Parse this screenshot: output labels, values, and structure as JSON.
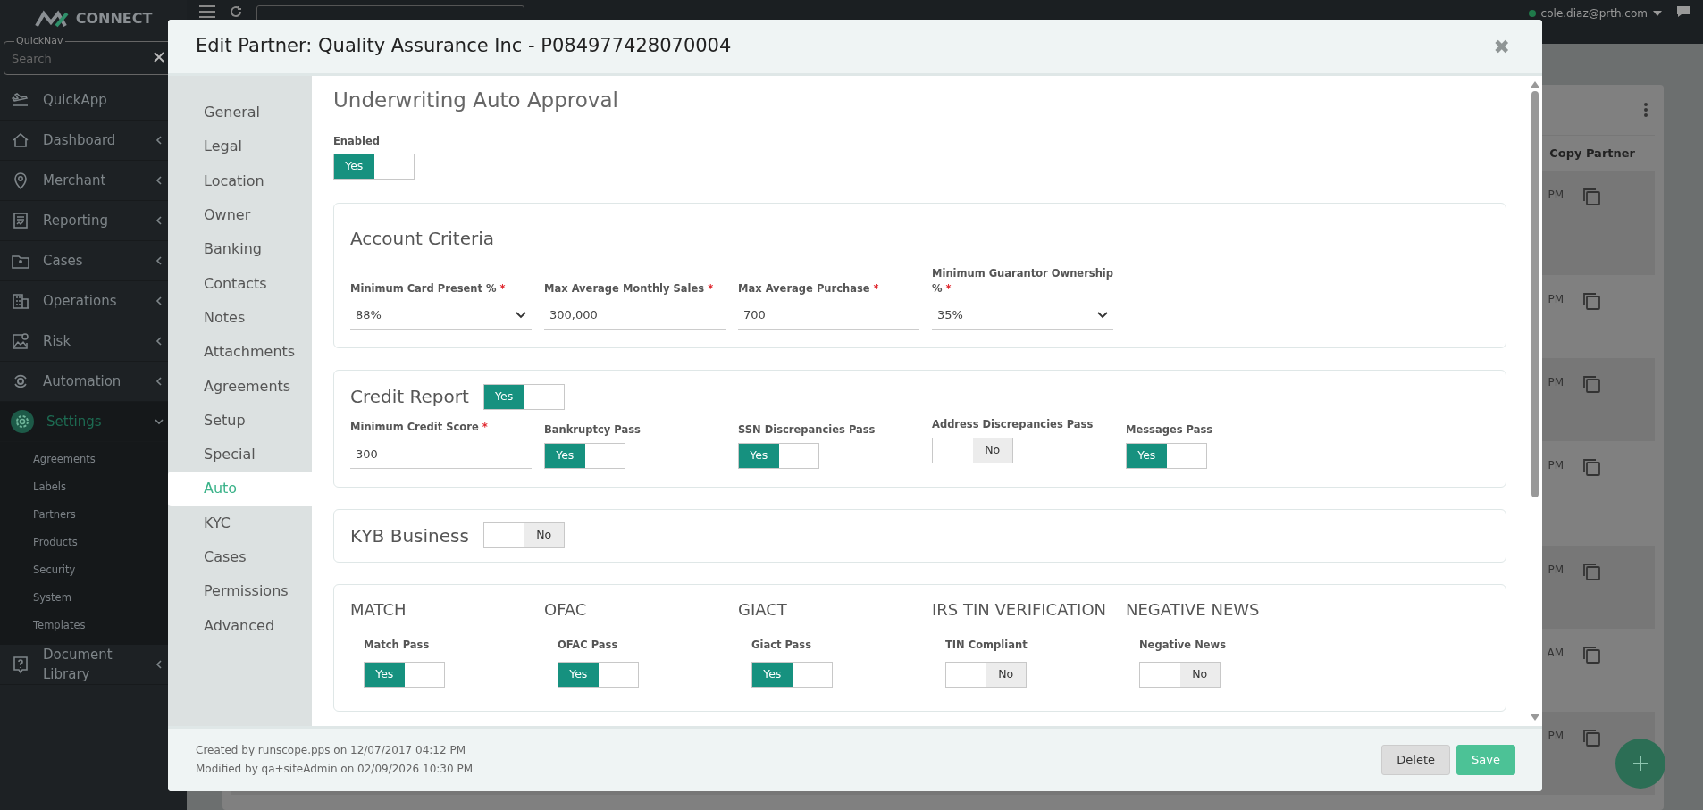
{
  "app": {
    "logo": "CONNECT",
    "quicknav": {
      "label": "QuickNav",
      "placeholder": "Search"
    },
    "user": "cole.diaz@prth.com"
  },
  "sidebar": {
    "items": [
      {
        "label": "QuickApp",
        "selected": false
      },
      {
        "label": "Dashboard",
        "selected": false,
        "expanded": false
      },
      {
        "label": "Merchant",
        "selected": false,
        "expanded": false
      },
      {
        "label": "Reporting",
        "selected": false,
        "expanded": false
      },
      {
        "label": "Cases",
        "selected": false,
        "expanded": false
      },
      {
        "label": "Operations",
        "selected": false,
        "expanded": false
      },
      {
        "label": "Risk",
        "selected": false,
        "expanded": false
      },
      {
        "label": "Automation",
        "selected": false,
        "expanded": false
      },
      {
        "label": "Settings",
        "selected": true,
        "expanded": true,
        "children": [
          {
            "label": "Agreements"
          },
          {
            "label": "Labels"
          },
          {
            "label": "Partners"
          },
          {
            "label": "Products"
          },
          {
            "label": "Security"
          },
          {
            "label": "System"
          },
          {
            "label": "Templates"
          }
        ]
      },
      {
        "label": "Document Library",
        "selected": false,
        "expanded": false
      }
    ]
  },
  "background_table": {
    "column": "Copy Partner",
    "rows": [
      {
        "column_1": "PM"
      },
      {
        "column_1": "PM"
      },
      {
        "column_1": "PM"
      },
      {
        "column_1": "PM"
      },
      {
        "column_1": "PM"
      },
      {
        "column_1": "AM"
      },
      {
        "column_1": "PM"
      }
    ]
  },
  "modal": {
    "title": "Edit Partner: Quality Assurance Inc - P084977428070004",
    "close": "✖",
    "nav": [
      {
        "label": "General",
        "selected": false
      },
      {
        "label": "Legal",
        "selected": false
      },
      {
        "label": "Location",
        "selected": false
      },
      {
        "label": "Owner",
        "selected": false
      },
      {
        "label": "Banking",
        "selected": false
      },
      {
        "label": "Contacts",
        "selected": false
      },
      {
        "label": "Notes",
        "selected": false
      },
      {
        "label": "Attachments",
        "selected": false
      },
      {
        "label": "Agreements",
        "selected": false
      },
      {
        "label": "Setup",
        "selected": false
      },
      {
        "label": "Special",
        "selected": false
      },
      {
        "label": "Auto",
        "selected": true
      },
      {
        "label": "KYC",
        "selected": false
      },
      {
        "label": "Cases",
        "selected": false
      },
      {
        "label": "Permissions",
        "selected": false
      },
      {
        "label": "Advanced",
        "selected": false
      }
    ],
    "heading": "Underwriting Auto Approval",
    "enabled": {
      "label": "Enabled",
      "on": true,
      "text": "Yes"
    },
    "sections": [
      {
        "kind": "criteria",
        "title": "Account Criteria",
        "fields": [
          {
            "kind": "select",
            "label": "Minimum Card Present %",
            "mark": "*",
            "value": "88%"
          },
          {
            "kind": "input",
            "label": "Max Average Monthly Sales",
            "mark": "*",
            "value": "300,000"
          },
          {
            "kind": "input",
            "label": "Max Average Purchase",
            "mark": "*",
            "value": "700"
          },
          {
            "kind": "select",
            "label": "Minimum Guarantor Ownership %",
            "mark": "*",
            "value": "35%"
          }
        ]
      },
      {
        "kind": "criteria",
        "title": "Credit Report",
        "toggle": {
          "on": true,
          "text": "Yes"
        },
        "fields": [
          {
            "kind": "input",
            "label": "Minimum Credit Score",
            "mark": "*",
            "value": "300"
          },
          {
            "kind": "toggle",
            "label": "Bankruptcy Pass",
            "on": true,
            "text": "Yes"
          },
          {
            "kind": "toggle",
            "label": "SSN Discrepancies Pass",
            "on": true,
            "text": "Yes"
          },
          {
            "kind": "toggle",
            "label": "Address Discrepancies Pass",
            "on": false,
            "text": "No"
          },
          {
            "kind": "toggle",
            "label": "Messages Pass",
            "on": true,
            "text": "Yes"
          }
        ]
      },
      {
        "kind": "criteria",
        "title": "KYB Business",
        "toggle": {
          "on": false,
          "text": "No"
        }
      },
      {
        "kind": "checks",
        "groups": [
          {
            "title": "MATCH",
            "label": "Match Pass",
            "on": true,
            "text": "Yes"
          },
          {
            "title": "OFAC",
            "label": "OFAC Pass",
            "on": true,
            "text": "Yes"
          },
          {
            "title": "GIACT",
            "label": "Giact Pass",
            "on": true,
            "text": "Yes"
          },
          {
            "title": "IRS TIN VERIFICATION",
            "label": "TIN Compliant",
            "on": false,
            "text": "No"
          },
          {
            "title": "NEGATIVE NEWS",
            "label": "Negative News",
            "on": false,
            "text": "No"
          }
        ]
      }
    ],
    "footer": {
      "created": "Created by runscope.pps on 12/07/2017 04:12 PM",
      "modified": "Modified by qa+siteAdmin on 02/09/2026 10:30 PM",
      "buttons": [
        {
          "label": "Delete",
          "kind": "secondary"
        },
        {
          "label": "Save",
          "kind": "primary"
        }
      ]
    }
  }
}
